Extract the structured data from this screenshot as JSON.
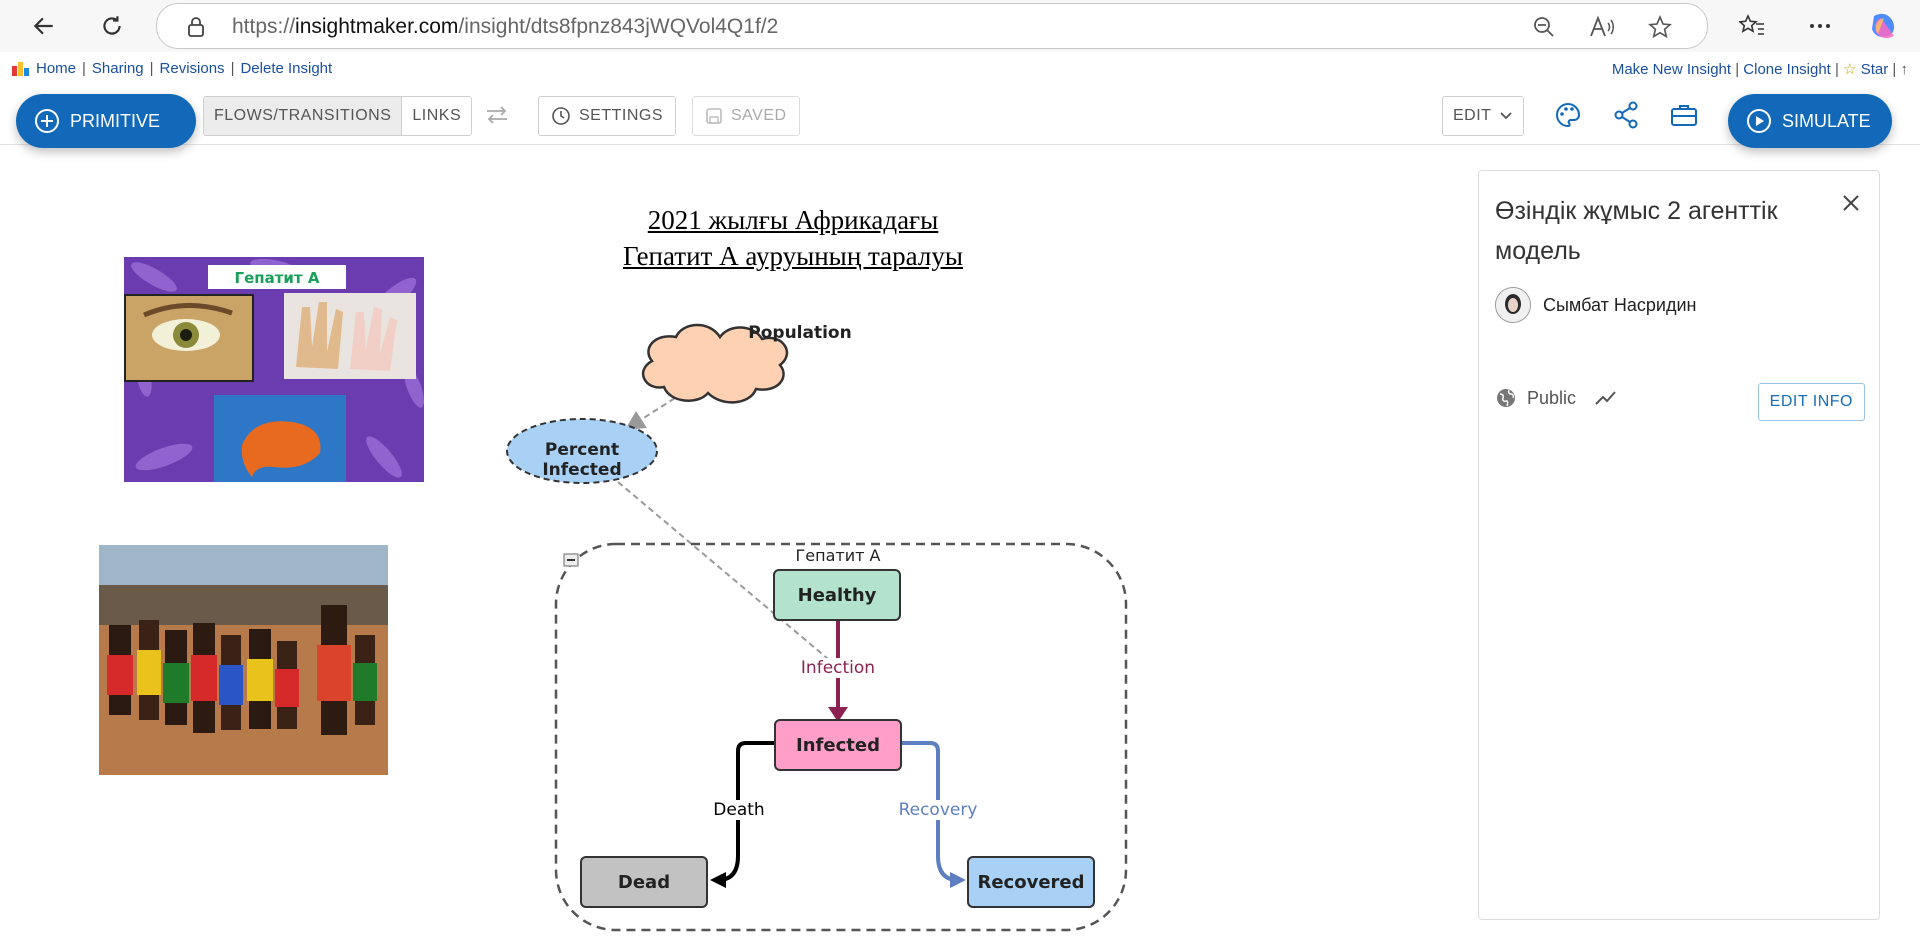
{
  "browser": {
    "url_prefix": "https://",
    "url_host": "insightmaker.com",
    "url_path": "/insight/dts8fpnz843jWQVol4Q1f/2"
  },
  "top_links": {
    "home": "Home",
    "sharing": "Sharing",
    "revisions": "Revisions",
    "delete": "Delete Insight",
    "make_new": "Make New Insight",
    "clone": "Clone Insight",
    "star": "Star",
    "separator": "|",
    "right_tail": "|  ↑"
  },
  "toolbar": {
    "primitive": "PRIMITIVE",
    "flows": "FLOWS/TRANSITIONS",
    "links": "LINKS",
    "settings": "SETTINGS",
    "saved": "SAVED",
    "edit": "EDIT",
    "simulate": "SIMULATE"
  },
  "canvas": {
    "title_line1": "2021 жылғы Африкадағы",
    "title_line2": "Гепатит А ауруының таралуы",
    "hep_image_label": "Гепатит А",
    "population": "Population",
    "percent_infected": "Percent Infected",
    "agent_group": "Гепатит А",
    "healthy": "Healthy",
    "infected": "Infected",
    "dead": "Dead",
    "recovered": "Recovered",
    "infection": "Infection",
    "death": "Death",
    "recovery": "Recovery",
    "colors": {
      "healthy": "#b3e2cd",
      "infected": "#ff9ec8",
      "dead": "#c2c2c2",
      "recovered": "#a9d1f5",
      "population": "#ffd1b3",
      "percent_infected": "#a9d1f5",
      "infection_flow": "#8b2252",
      "recovery_flow": "#5e7fbf",
      "death_flow": "#000000"
    }
  },
  "info_panel": {
    "title": "Өзіндік жұмыс 2 агенттік модель",
    "author": "Сымбат Насридин",
    "visibility": "Public",
    "edit_info": "EDIT INFO"
  }
}
